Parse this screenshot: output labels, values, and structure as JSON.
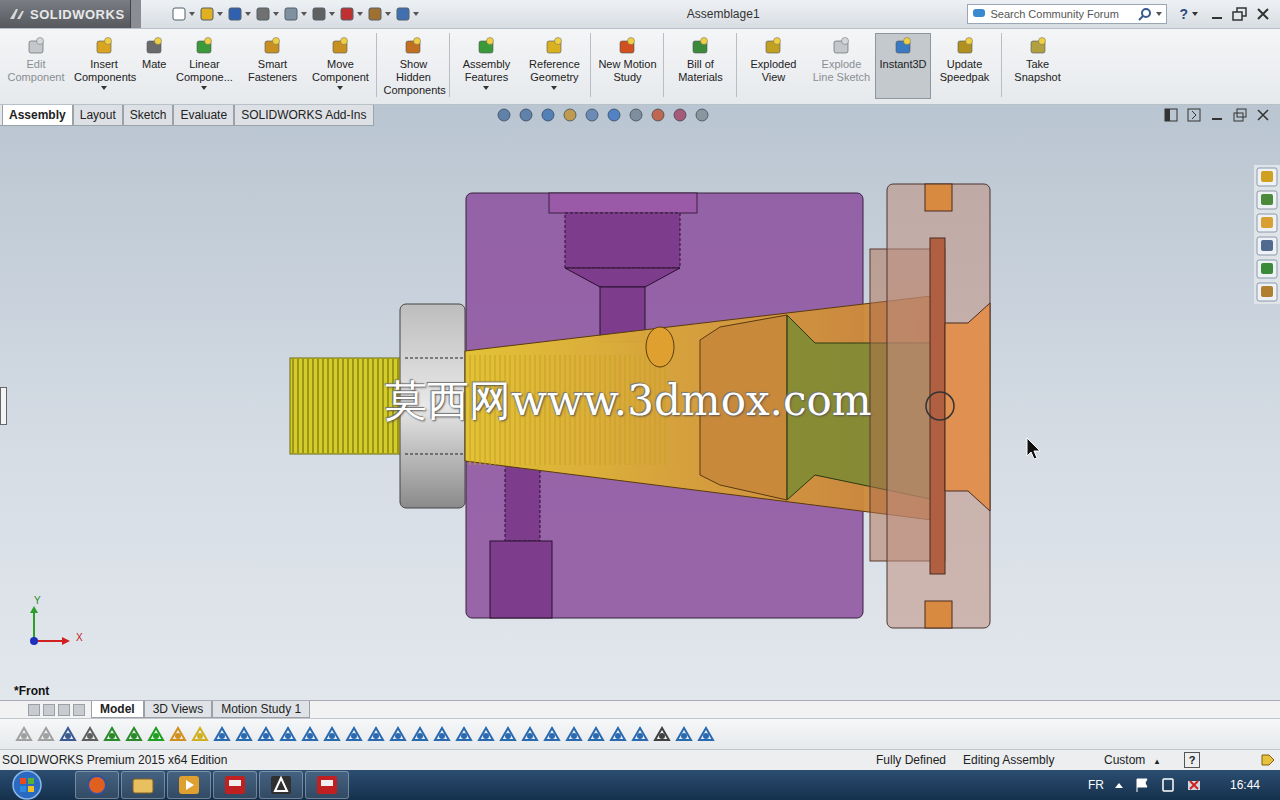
{
  "window": {
    "logo": "SOLIDWORKS",
    "title": "Assemblage1"
  },
  "search": {
    "placeholder": "Search Community Forum"
  },
  "help": "?",
  "ribbon": [
    {
      "label": "Edit Component",
      "disabled": true,
      "selected": false,
      "has_menu": false,
      "separator_after": false
    },
    {
      "label": "Insert Components",
      "disabled": false,
      "selected": false,
      "has_menu": true,
      "separator_after": false
    },
    {
      "label": "Mate",
      "disabled": false,
      "selected": false,
      "has_menu": false,
      "separator_after": false
    },
    {
      "label": "Linear Compone...",
      "disabled": false,
      "selected": false,
      "has_menu": true,
      "separator_after": false
    },
    {
      "label": "Smart Fasteners",
      "disabled": false,
      "selected": false,
      "has_menu": false,
      "separator_after": false
    },
    {
      "label": "Move Component",
      "disabled": false,
      "selected": false,
      "has_menu": true,
      "separator_after": true
    },
    {
      "label": "Show Hidden Components",
      "disabled": false,
      "selected": false,
      "has_menu": false,
      "separator_after": true
    },
    {
      "label": "Assembly Features",
      "disabled": false,
      "selected": false,
      "has_menu": true,
      "separator_after": false
    },
    {
      "label": "Reference Geometry",
      "disabled": false,
      "selected": false,
      "has_menu": true,
      "separator_after": true
    },
    {
      "label": "New Motion Study",
      "disabled": false,
      "selected": false,
      "has_menu": false,
      "separator_after": true
    },
    {
      "label": "Bill of Materials",
      "disabled": false,
      "selected": false,
      "has_menu": false,
      "separator_after": true
    },
    {
      "label": "Exploded View",
      "disabled": false,
      "selected": false,
      "has_menu": false,
      "separator_after": false
    },
    {
      "label": "Explode Line Sketch",
      "disabled": true,
      "selected": false,
      "has_menu": false,
      "separator_after": false
    },
    {
      "label": "Instant3D",
      "disabled": false,
      "selected": true,
      "has_menu": false,
      "separator_after": false
    },
    {
      "label": "Update Speedpak",
      "disabled": false,
      "selected": false,
      "has_menu": false,
      "separator_after": true
    },
    {
      "label": "Take Snapshot",
      "disabled": false,
      "selected": false,
      "has_menu": false,
      "separator_after": false
    }
  ],
  "command_tabs": [
    {
      "label": "Assembly",
      "selected": true
    },
    {
      "label": "Layout",
      "selected": false
    },
    {
      "label": "Sketch",
      "selected": false
    },
    {
      "label": "Evaluate",
      "selected": false
    },
    {
      "label": "SOLIDWORKS Add-Ins",
      "selected": false
    }
  ],
  "viewport": {
    "watermark": "莫西网www.3dmox.com",
    "view_name": "*Front",
    "triad": {
      "y": "Y",
      "x": "X"
    }
  },
  "bottom_tabs": [
    {
      "label": "Model",
      "selected": true
    },
    {
      "label": "3D Views",
      "selected": false
    },
    {
      "label": "Motion Study 1",
      "selected": false
    }
  ],
  "status_bar": {
    "edition": "SOLIDWORKS Premium 2015 x64 Edition",
    "state": "Fully Defined",
    "mode": "Editing Assembly",
    "units": "Custom",
    "units_arrow": "▴",
    "help": "?"
  },
  "taskbar": {
    "apps": [
      {
        "kind": "firefox"
      },
      {
        "kind": "explorer"
      },
      {
        "kind": "media"
      },
      {
        "kind": "solidworks"
      },
      {
        "kind": "autocad"
      },
      {
        "kind": "solidworks"
      }
    ],
    "language": "FR",
    "clock": "16:44"
  }
}
